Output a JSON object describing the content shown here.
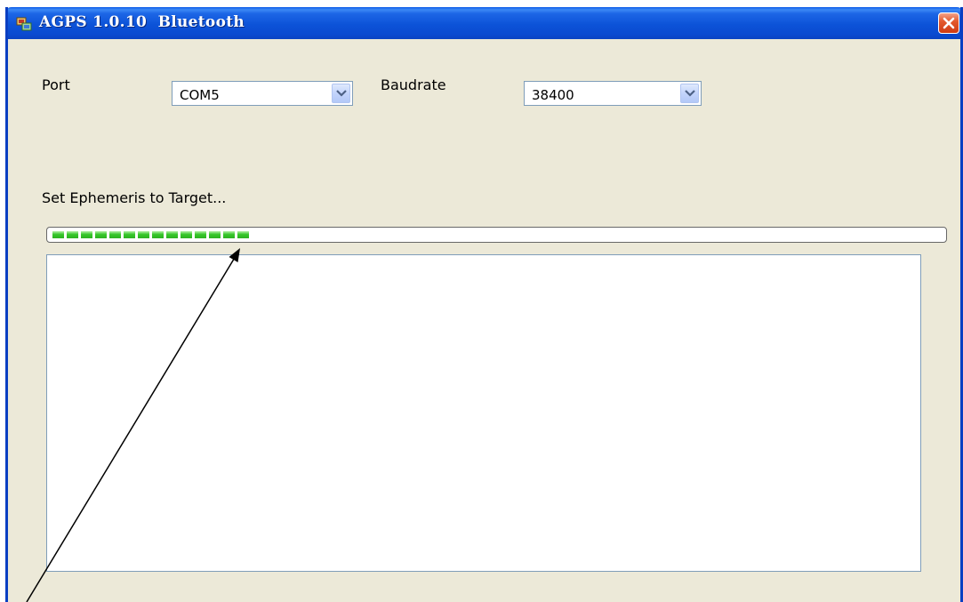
{
  "window": {
    "title": "AGPS 1.0.10  Bluetooth",
    "app_icon": "app-icon",
    "close_icon": "close-icon"
  },
  "port": {
    "label": "Port",
    "value": "COM5"
  },
  "baudrate": {
    "label": "Baudrate",
    "value": "38400"
  },
  "status": {
    "text": "Set Ephemeris to Target..."
  },
  "progress": {
    "fraction": 0.23,
    "color": "#37c72b"
  },
  "log": {
    "content": ""
  },
  "colors": {
    "titlebar": "#0c53d8",
    "window_bg": "#ece9d8",
    "close_button": "#e35a2e"
  }
}
